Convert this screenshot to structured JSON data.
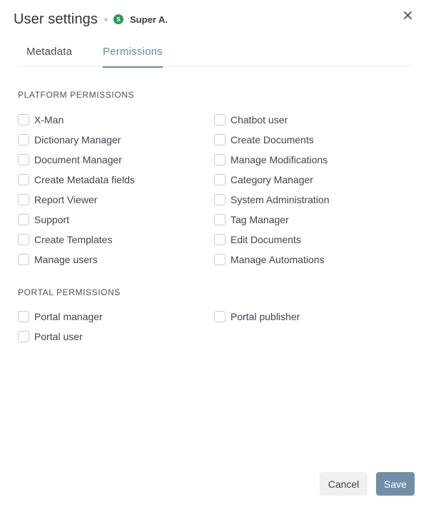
{
  "header": {
    "title": "User settings",
    "user": {
      "initial": "S",
      "name": "Super A.",
      "avatar_color": "#2c9a5a"
    }
  },
  "tabs": [
    {
      "label": "Metadata",
      "active": false
    },
    {
      "label": "Permissions",
      "active": true
    }
  ],
  "accent_color": "#5d8aa8",
  "sections": {
    "platform": {
      "title": "PLATFORM PERMISSIONS",
      "rows": [
        [
          {
            "label": "X-Man",
            "checked": false
          },
          {
            "label": "Chatbot user",
            "checked": false
          }
        ],
        [
          {
            "label": "Dictionary Manager",
            "checked": false
          },
          {
            "label": "Create Documents",
            "checked": false
          }
        ],
        [
          {
            "label": "Document Manager",
            "checked": false
          },
          {
            "label": "Manage Modifications",
            "checked": false
          }
        ],
        [
          {
            "label": "Create Metadata fields",
            "checked": false
          },
          {
            "label": "Category Manager",
            "checked": false
          }
        ],
        [
          {
            "label": "Report Viewer",
            "checked": false
          },
          {
            "label": "System Administration",
            "checked": false
          }
        ],
        [
          {
            "label": "Support",
            "checked": false
          },
          {
            "label": "Tag Manager",
            "checked": false
          }
        ],
        [
          {
            "label": "Create Templates",
            "checked": false
          },
          {
            "label": "Edit Documents",
            "checked": false
          }
        ],
        [
          {
            "label": "Manage users",
            "checked": false
          },
          {
            "label": "Manage Automations",
            "checked": false
          }
        ]
      ]
    },
    "portal": {
      "title": "PORTAL PERMISSIONS",
      "rows": [
        [
          {
            "label": "Portal manager",
            "checked": false
          },
          {
            "label": "Portal publisher",
            "checked": false
          }
        ],
        [
          {
            "label": "Portal user",
            "checked": false
          }
        ]
      ]
    }
  },
  "footer": {
    "cancel_label": "Cancel",
    "save_label": "Save"
  },
  "icons": {
    "close": "close-icon"
  }
}
